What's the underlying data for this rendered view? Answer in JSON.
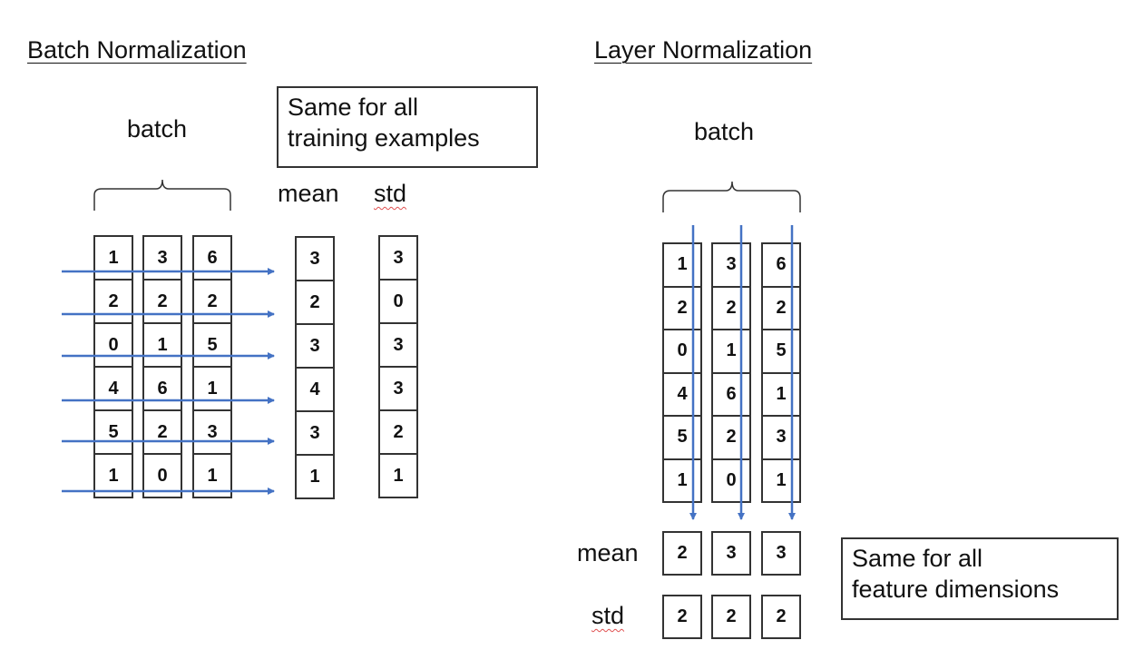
{
  "batch_norm": {
    "title": "Batch Normalization",
    "batch_label": "batch",
    "note_line1": "Same for all",
    "note_line2": "training examples",
    "mean_label": "mean",
    "std_label": "std",
    "matrix": [
      [
        1,
        3,
        6
      ],
      [
        2,
        2,
        2
      ],
      [
        0,
        1,
        5
      ],
      [
        4,
        6,
        1
      ],
      [
        5,
        2,
        3
      ],
      [
        1,
        0,
        1
      ]
    ],
    "mean": [
      3,
      2,
      3,
      4,
      3,
      1
    ],
    "std": [
      3,
      0,
      3,
      3,
      2,
      1
    ]
  },
  "layer_norm": {
    "title": "Layer Normalization",
    "batch_label": "batch",
    "note_line1": "Same for all",
    "note_line2": "feature dimensions",
    "mean_label": "mean",
    "std_label": "std",
    "matrix": [
      [
        1,
        3,
        6
      ],
      [
        2,
        2,
        2
      ],
      [
        0,
        1,
        5
      ],
      [
        4,
        6,
        1
      ],
      [
        5,
        2,
        3
      ],
      [
        1,
        0,
        1
      ]
    ],
    "mean": [
      2,
      3,
      3
    ],
    "std": [
      2,
      2,
      2
    ]
  },
  "colors": {
    "arrow": "#4472c4",
    "border": "#333333",
    "spellcheck": "#e05050"
  }
}
